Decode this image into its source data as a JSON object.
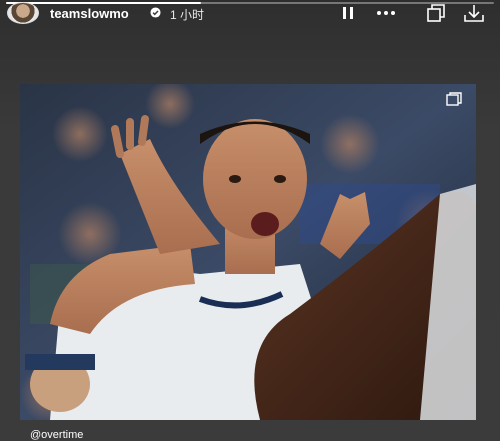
{
  "story": {
    "username": "teamslowmo",
    "verified": true,
    "time_label": "1 小时",
    "progress_percent": 40
  },
  "actions": {
    "pause": "pause-icon",
    "more": "more-icon",
    "copy": "copy-icon",
    "download": "download-icon"
  },
  "post": {
    "mention": "@overtime"
  },
  "colors": {
    "background": "#3b3b3b",
    "text": "#ffffff"
  }
}
